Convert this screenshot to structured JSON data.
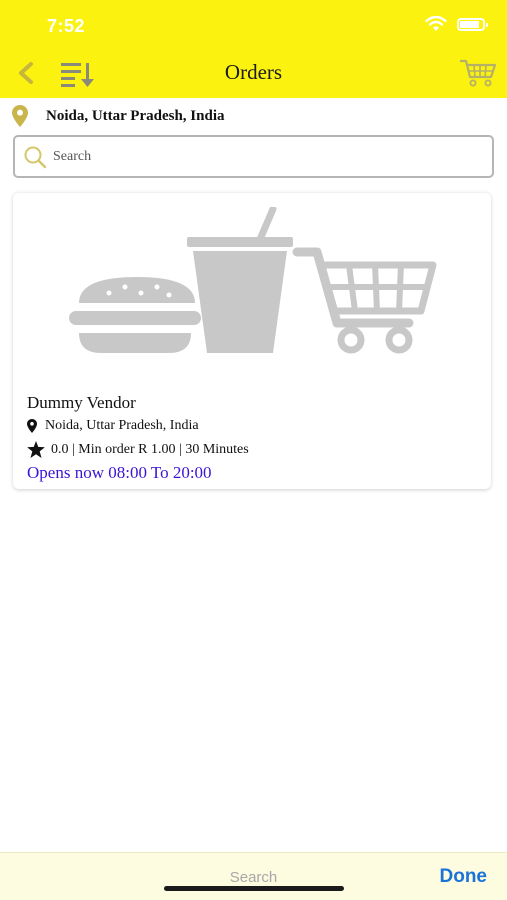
{
  "status_bar": {
    "time": "7:52"
  },
  "header": {
    "title": "Orders",
    "back_icon": "chevron-left-icon",
    "sort_icon": "sort-icon",
    "cart_icon": "cart-icon",
    "background": "#fbf20f"
  },
  "location": {
    "text": "Noida, Uttar Pradesh, India",
    "icon": "location-pin-icon",
    "icon_color": "#c9b54a"
  },
  "search": {
    "placeholder": "Search",
    "value": ""
  },
  "vendors": [
    {
      "name": "Dummy Vendor",
      "address": "Noida, Uttar Pradesh, India",
      "meta": "0.0 | Min order R 1.00 | 30 Minutes",
      "hours": "Opens now 08:00 To 20:00",
      "hours_color": "#3b13d6",
      "image": "food-cart-placeholder-image"
    }
  ],
  "keyboard_bar": {
    "search_label": "Search",
    "done_label": "Done"
  }
}
